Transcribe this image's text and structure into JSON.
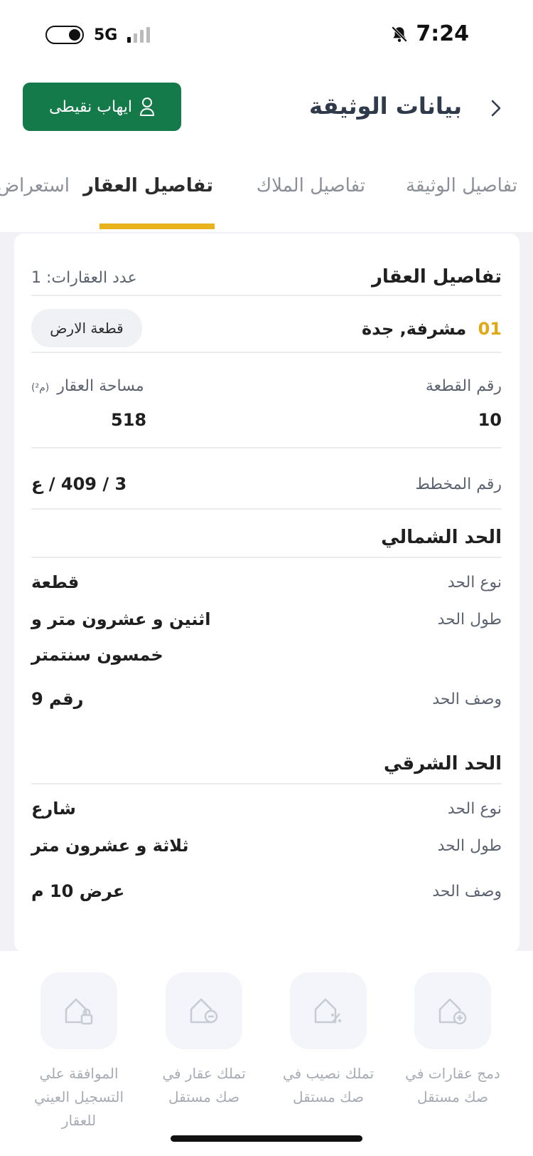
{
  "status_bar": {
    "network": "5G",
    "time": "7:24"
  },
  "header": {
    "title": "بيانات الوثيقة",
    "user_name": "ايهاب نقيطى"
  },
  "tabs": [
    {
      "label": "تفاصيل الوثيقة"
    },
    {
      "label": "تفاصيل الملاك"
    },
    {
      "label": "تفاصيل العقار"
    },
    {
      "label": "استعراض"
    }
  ],
  "active_tab": "تفاصيل العقار",
  "property": {
    "section_title": "تفاصيل العقار",
    "count_label": "عدد العقارات: 1",
    "index": "01",
    "location": "مشرفة, جدة",
    "type_chip": "قطعة الارض",
    "plot_number_label": "رقم القطعة",
    "plot_number": "10",
    "area_label": "مساحة العقار",
    "area_unit": "(م²)",
    "area": "518",
    "plan_label": "رقم المخطط",
    "plan_number": "3 / 409 / ع"
  },
  "north_boundary": {
    "title": "الحد الشمالي",
    "type_label": "نوع الحد",
    "type_value": "قطعة",
    "length_label": "طول الحد",
    "length_value_line1": "اثنين و عشرون متر و",
    "length_value_line2": "خمسون سنتمتر",
    "desc_label": "وصف الحد",
    "desc_value": "رقم 9"
  },
  "east_boundary": {
    "title": "الحد الشرقي",
    "type_label": "نوع الحد",
    "type_value": "شارع",
    "length_label": "طول الحد",
    "length_value": "ثلاثة و عشرون متر",
    "desc_label": "وصف الحد",
    "desc_value": "عرض 10 م"
  },
  "actions": [
    {
      "icon": "home-plus-icon",
      "line1": "دمج عقارات في",
      "line2": "صك مستقل"
    },
    {
      "icon": "home-percent-icon",
      "line1": "تملك نصيب في",
      "line2": "صك مستقل"
    },
    {
      "icon": "home-minus-icon",
      "line1": "تملك عقار في",
      "line2": "صك مستقل"
    },
    {
      "icon": "home-lock-icon",
      "line1": "الموافقة علي",
      "line2": "التسجيل العيني",
      "line3": "للعقار"
    }
  ]
}
